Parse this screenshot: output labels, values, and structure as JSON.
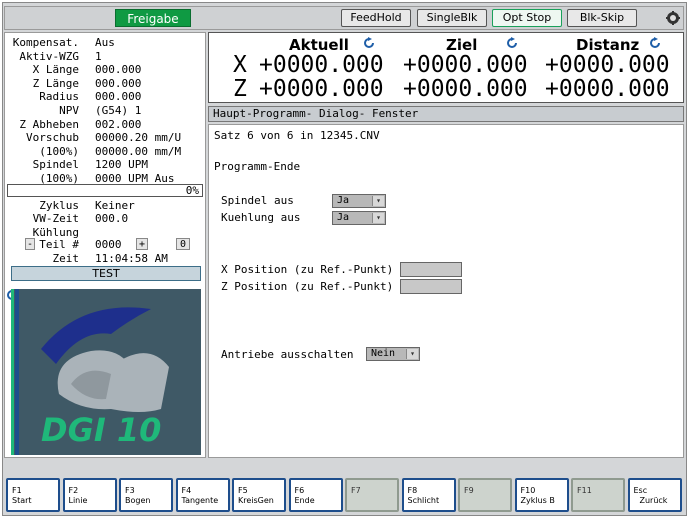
{
  "topbar": {
    "freigabe": "Freigabe",
    "buttons": [
      "FeedHold",
      "SingleBlk",
      "Opt Stop",
      "Blk-Skip"
    ]
  },
  "left": {
    "rows": [
      {
        "label": "Kompensat.",
        "value": "Aus"
      },
      {
        "label": "Aktiv-WZG",
        "value": "1"
      },
      {
        "label": "X Länge",
        "value": "000.000"
      },
      {
        "label": "Z Länge",
        "value": "000.000"
      },
      {
        "label": "Radius",
        "value": "000.000"
      },
      {
        "label": "NPV",
        "value": "(G54) 1"
      },
      {
        "label": "Z Abheben",
        "value": "002.000"
      },
      {
        "label": "Vorschub",
        "value": "00000.20 mm/U"
      },
      {
        "label": "(100%)",
        "value": "00000.00 mm/M"
      },
      {
        "label": "Spindel",
        "value": "1200 UPM"
      },
      {
        "label": "(100%)",
        "value": "0000 UPM Aus"
      }
    ],
    "progress_pct": "0%",
    "rows2": [
      {
        "label": "Zyklus",
        "value": "Keiner"
      },
      {
        "label": "VW-Zeit",
        "value": "000.0"
      },
      {
        "label": "Kühlung",
        "value": ""
      }
    ],
    "teil_minus": "-",
    "teil_label": "Teil #",
    "teil_value": "0000",
    "teil_plus": "+",
    "teil_zero": "0",
    "zeit_label": "Zeit",
    "zeit_value": "11:04:58 AM",
    "test": "TEST",
    "logo_text": "DGI 10"
  },
  "coords": {
    "headers": [
      "Aktuell",
      "Ziel",
      "Distanz"
    ],
    "x_label": "X",
    "z_label": "Z",
    "x_values": [
      "+0000.000",
      "+0000.000",
      "+0000.000"
    ],
    "z_values": [
      "+0000.000",
      "+0000.000",
      "+0000.000"
    ]
  },
  "dialog": {
    "header": "Haupt-Programm-  Dialog- Fenster",
    "satz": "Satz 6 von 6 in 12345.CNV",
    "title": "Programm-Ende",
    "spindel_label": "Spindel aus",
    "spindel_value": "Ja",
    "kuehlung_label": "Kuehlung aus",
    "kuehlung_value": "Ja",
    "xpos_label": "X Position (zu Ref.-Punkt)",
    "zpos_label": "Z Position (zu Ref.-Punkt)",
    "antriebe_label": "Antriebe ausschalten",
    "antriebe_value": "Nein"
  },
  "fkeys": [
    {
      "key": "F1",
      "label": "Start",
      "enabled": true
    },
    {
      "key": "F2",
      "label": "Linie",
      "enabled": true
    },
    {
      "key": "F3",
      "label": "Bogen",
      "enabled": true
    },
    {
      "key": "F4",
      "label": "Tangente",
      "enabled": true
    },
    {
      "key": "F5",
      "label": "KreisGen",
      "enabled": true
    },
    {
      "key": "F6",
      "label": "Ende",
      "enabled": true
    },
    {
      "key": "F7",
      "label": "",
      "enabled": false
    },
    {
      "key": "F8",
      "label": "Schlicht",
      "enabled": true
    },
    {
      "key": "F9",
      "label": "",
      "enabled": false
    },
    {
      "key": "F10",
      "label": "Zyklus B",
      "enabled": true
    },
    {
      "key": "F11",
      "label": "",
      "enabled": false
    },
    {
      "key": "Esc",
      "label": "Zurück",
      "enabled": true
    }
  ],
  "colors": {
    "freigabe": "#0f9a43",
    "fkey_border": "#1e4e8c",
    "logo_green": "#1fb87a",
    "logo_blue": "#1e2f8c"
  }
}
